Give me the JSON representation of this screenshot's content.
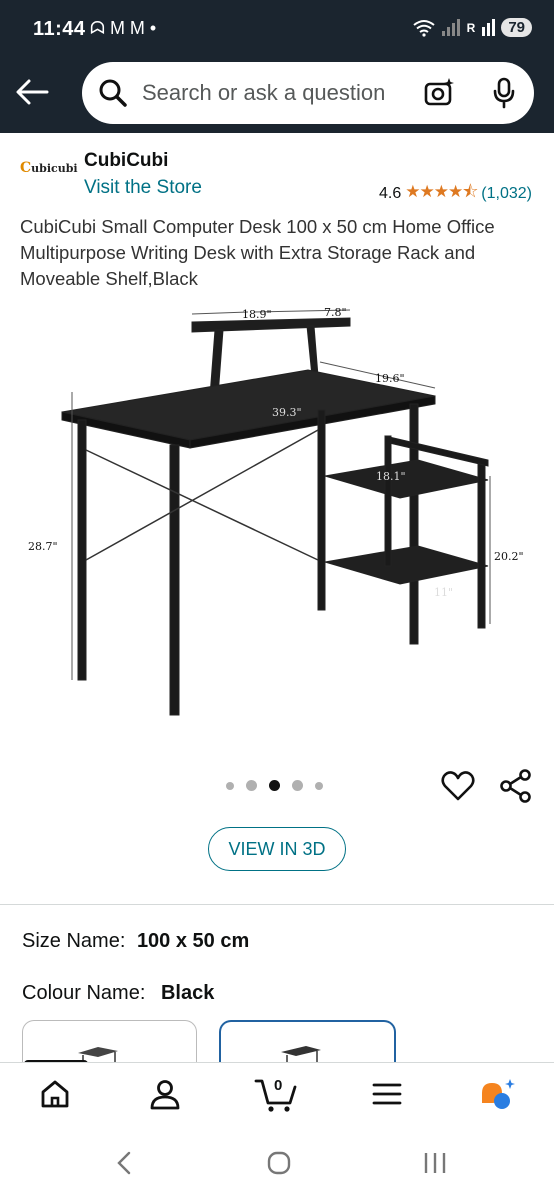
{
  "status": {
    "time": "11:44",
    "notif_icons": "ᗣ M M •",
    "signal": "R",
    "battery": "79"
  },
  "search": {
    "placeholder": "Search or ask a question"
  },
  "brand": {
    "logo_text": "ubicubi",
    "logo_initial": "C",
    "name": "CubiCubi",
    "visit_store": "Visit the Store"
  },
  "rating": {
    "value": "4.6",
    "stars": "★★★★⯪",
    "count": "(1,032)"
  },
  "product": {
    "title": "CubiCubi Small Computer Desk 100 x 50 cm Home Office Multipurpose Writing Desk with Extra Storage Rack and Moveable Shelf,Black",
    "dimensions": {
      "shelf_width": "18.9\"",
      "shelf_depth": "7.8\"",
      "desk_width": "39.3\"",
      "desk_depth": "19.6\"",
      "height": "28.7\"",
      "rack_width": "18.1\"",
      "rack_height": "20.2\"",
      "rack_depth": "11\""
    },
    "image_count": 5,
    "image_index": 3,
    "view_3d": "VIEW IN 3D"
  },
  "options": {
    "size_label": "Size Name:",
    "size_value": "100 x 50 cm",
    "colour_label": "Colour Name:",
    "colour_value": "Black"
  },
  "bottom_nav": {
    "cart_count": "0",
    "items": [
      "home-icon",
      "account-icon",
      "cart-icon",
      "menu-icon",
      "rufus-icon"
    ]
  },
  "colors": {
    "header_bg": "#1b252f",
    "link": "#007185",
    "star": "#de7921",
    "selected_border": "#2162a1"
  }
}
